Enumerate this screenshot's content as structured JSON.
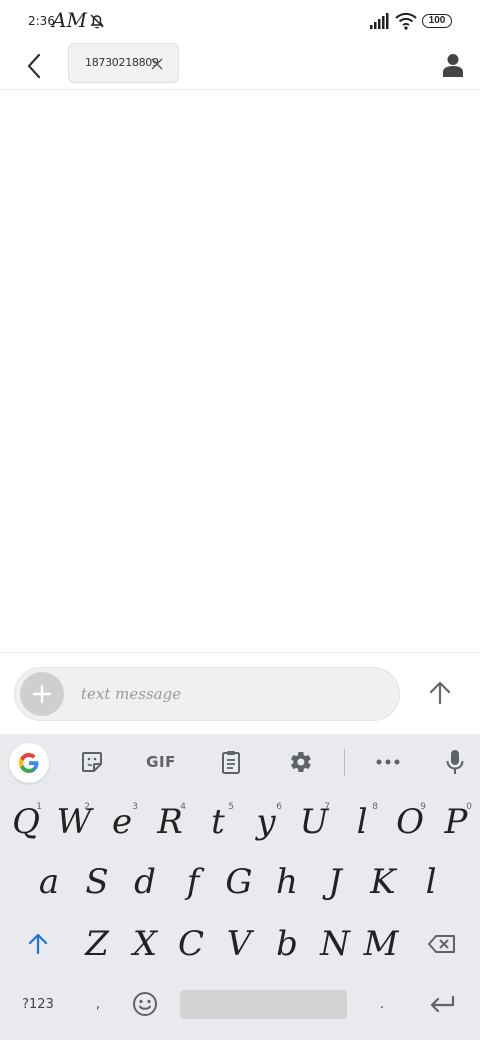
{
  "status_bar": {
    "time": "2:36",
    "ampm": "AM",
    "battery": "100"
  },
  "header": {
    "recipient_chip": "18730218809"
  },
  "composer": {
    "placeholder": "text message"
  },
  "keyboard": {
    "toolbar": {
      "gif_label": "GIF"
    },
    "row1": [
      {
        "label": "Q",
        "hint": "1"
      },
      {
        "label": "W",
        "hint": "2"
      },
      {
        "label": "e",
        "hint": "3"
      },
      {
        "label": "R",
        "hint": "4"
      },
      {
        "label": "t",
        "hint": "5"
      },
      {
        "label": "y",
        "hint": "6"
      },
      {
        "label": "U",
        "hint": "7"
      },
      {
        "label": "l",
        "hint": "8"
      },
      {
        "label": "O",
        "hint": "9"
      },
      {
        "label": "P",
        "hint": "0"
      }
    ],
    "row2": [
      "a",
      "S",
      "d",
      "f",
      "G",
      "h",
      "J",
      "K",
      "l"
    ],
    "row3": [
      "Z",
      "X",
      "C",
      "V",
      "b",
      "N",
      "M"
    ],
    "symbols_key": "?123",
    "comma_key": ",",
    "period_key": "."
  }
}
